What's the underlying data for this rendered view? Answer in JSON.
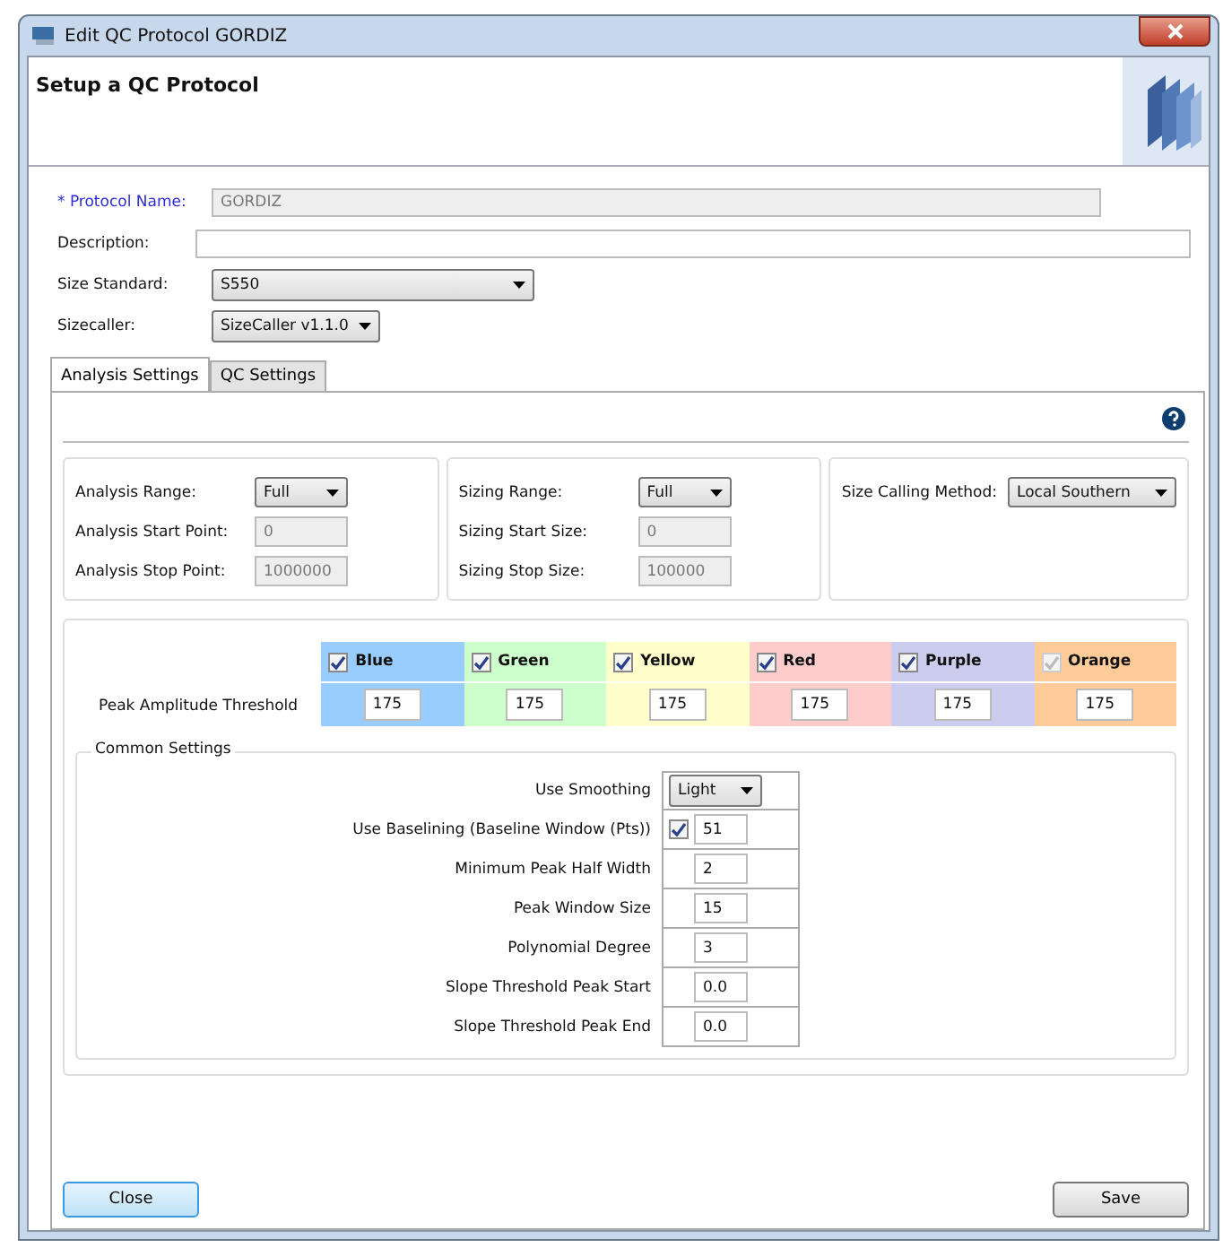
{
  "window": {
    "title": "Edit QC Protocol GORDIZ"
  },
  "header": {
    "title": "Setup a QC Protocol"
  },
  "form": [
    {
      "kind": "text",
      "label": "* Protocol Name:",
      "required": true,
      "disabled": true,
      "value": "GORDIZ"
    },
    {
      "kind": "text",
      "label": "Description:",
      "required": false,
      "disabled": false
    },
    {
      "kind": "select",
      "label": "Size Standard:",
      "value": "S550"
    },
    {
      "kind": "select",
      "label": "Sizecaller:",
      "value": "SizeCaller v1.1.0"
    }
  ],
  "tabs": [
    {
      "label": "Analysis Settings",
      "selected": true
    },
    {
      "label": "QC Settings",
      "selected": false
    }
  ],
  "groups": [
    {
      "rows": [
        {
          "kind": "select",
          "label": "Analysis Range:",
          "value": "Full"
        },
        {
          "kind": "text",
          "label": "Analysis Start Point:",
          "value": "0",
          "disabled": true
        },
        {
          "kind": "text",
          "label": "Analysis Stop Point:",
          "value": "1000000",
          "disabled": true
        }
      ]
    },
    {
      "rows": [
        {
          "kind": "select",
          "label": "Sizing Range:",
          "value": "Full"
        },
        {
          "kind": "text",
          "label": "Sizing Start Size:",
          "value": "0",
          "disabled": true
        },
        {
          "kind": "text",
          "label": "Sizing Stop Size:",
          "value": "100000",
          "disabled": true
        }
      ]
    },
    {
      "rows": [
        {
          "kind": "select",
          "label": "Size Calling Method:",
          "value": "Local Southern"
        }
      ]
    }
  ],
  "dyes": {
    "row_label": "Peak Amplitude Threshold",
    "channels": [
      {
        "name": "Blue",
        "color": "#99ccff",
        "checked": true,
        "disabled": false,
        "value": "175"
      },
      {
        "name": "Green",
        "color": "#ccffcc",
        "checked": true,
        "disabled": false,
        "value": "175"
      },
      {
        "name": "Yellow",
        "color": "#ffffcc",
        "checked": true,
        "disabled": false,
        "value": "175"
      },
      {
        "name": "Red",
        "color": "#ffcccc",
        "checked": true,
        "disabled": false,
        "value": "175"
      },
      {
        "name": "Purple",
        "color": "#ccccee",
        "checked": true,
        "disabled": false,
        "value": "175"
      },
      {
        "name": "Orange",
        "color": "#ffcc99",
        "checked": true,
        "disabled": true,
        "value": "175"
      }
    ]
  },
  "common_settings": {
    "title": "Common Settings",
    "rows": [
      {
        "kind": "select",
        "label": "Use Smoothing",
        "value": "Light"
      },
      {
        "kind": "check_text",
        "label": "Use Baselining (Baseline Window (Pts))",
        "value": "51",
        "checked": true
      },
      {
        "kind": "text",
        "label": "Minimum Peak Half Width",
        "value": "2"
      },
      {
        "kind": "text",
        "label": "Peak Window Size",
        "value": "15"
      },
      {
        "kind": "text",
        "label": "Polynomial Degree",
        "value": "3"
      },
      {
        "kind": "text",
        "label": "Slope Threshold Peak Start",
        "value": "0.0"
      },
      {
        "kind": "text",
        "label": "Slope Threshold Peak End",
        "value": "0.0"
      }
    ]
  },
  "buttons": [
    {
      "label": "Close",
      "default": true
    },
    {
      "label": "Save",
      "default": false
    }
  ]
}
